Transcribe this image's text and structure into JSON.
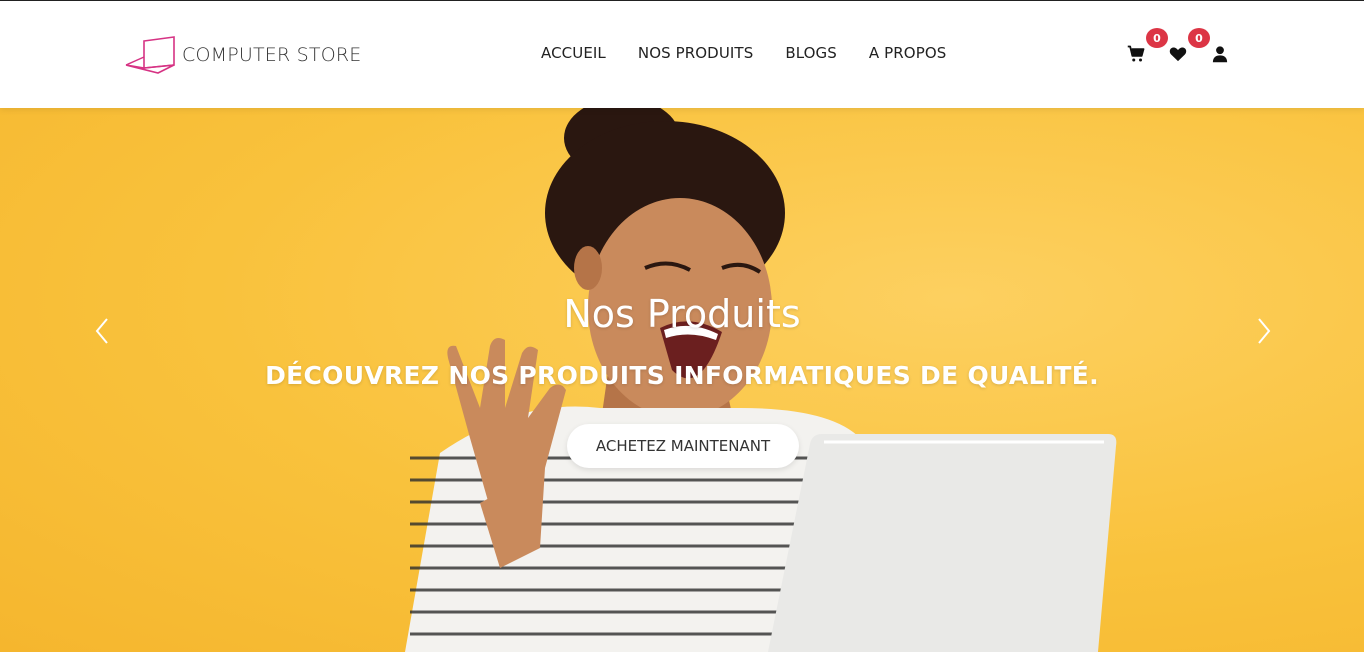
{
  "brand": {
    "name": "COMPUTER STORE",
    "accent": "#d63384"
  },
  "nav": {
    "items": [
      "ACCUEIL",
      "NOS PRODUITS",
      "BLOGS",
      "A PROPOS"
    ]
  },
  "header_icons": {
    "cart": {
      "icon": "cart-icon",
      "count": "0"
    },
    "wishlist": {
      "icon": "heart-icon",
      "count": "0"
    },
    "account": {
      "icon": "user-icon"
    },
    "badge_color": "#dc3545"
  },
  "hero": {
    "title": "Nos Produits",
    "subtitle": "DÉCOUVREZ NOS PRODUITS INFORMATIQUES DE QUALITÉ.",
    "cta_label": "ACHETEZ MAINTENANT",
    "background_color": "#f9c23c",
    "prev_icon": "chevron-left-icon",
    "next_icon": "chevron-right-icon"
  }
}
